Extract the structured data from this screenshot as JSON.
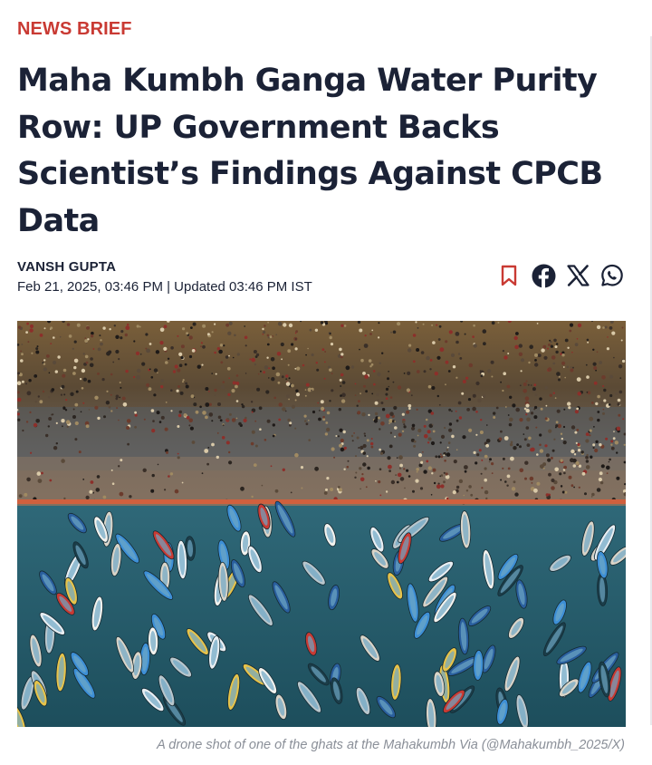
{
  "article": {
    "kicker": "NEWS BRIEF",
    "headline": "Maha Kumbh Ganga Water Purity Row: UP Government Backs Scientist’s Findings Against CPCB Data",
    "author": "VANSH GUPTA",
    "dateline": "Feb 21, 2025, 03:46 PM | Updated 03:46 PM IST"
  },
  "actions": {
    "icons": [
      "bookmark-icon",
      "facebook-icon",
      "x-icon",
      "whatsapp-icon"
    ]
  },
  "image": {
    "caption": "A drone shot of one of the ghats at the Mahakumbh Via (@Mahakumbh_2025/X)"
  },
  "colors": {
    "kicker": "#c93a33",
    "headline": "#1b2236",
    "caption": "#8a8f98",
    "bookmark": "#c93a33"
  }
}
